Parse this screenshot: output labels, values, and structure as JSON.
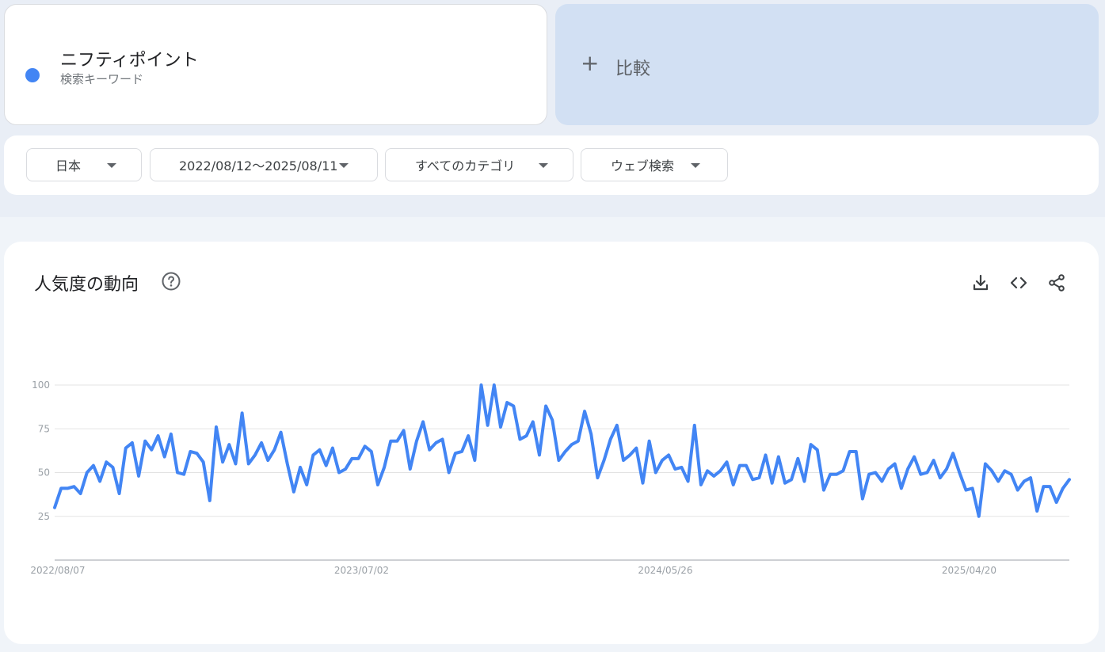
{
  "term": {
    "title": "ニフティポイント",
    "subtitle": "検索キーワード",
    "color": "#4285f4"
  },
  "compare": {
    "plus": "+",
    "label": "比較"
  },
  "filters": {
    "region": "日本",
    "date_range": "2022/08/12〜2025/08/11",
    "category": "すべてのカテゴリ",
    "search_type": "ウェブ検索"
  },
  "chart_card": {
    "title": "人気度の動向",
    "icons": [
      "help-icon",
      "download-icon",
      "embed-code-icon",
      "share-icon"
    ]
  },
  "chart_data": {
    "type": "line",
    "ylim": [
      0,
      100
    ],
    "yticks": [
      25,
      50,
      75,
      100
    ],
    "xtick_labels": [
      "2022/08/07",
      "2023/07/02",
      "2024/05/26",
      "2025/04/20"
    ],
    "grid": true,
    "series": [
      {
        "color": "#4285f4",
        "x_start": "2022/08/07",
        "x_interval_days": 7,
        "values": [
          30,
          41,
          41,
          42,
          38,
          50,
          54,
          45,
          56,
          53,
          38,
          64,
          67,
          48,
          68,
          63,
          71,
          59,
          72,
          50,
          49,
          62,
          61,
          56,
          34,
          76,
          56,
          66,
          55,
          84,
          55,
          60,
          67,
          57,
          63,
          73,
          55,
          39,
          53,
          43,
          60,
          63,
          54,
          64,
          50,
          52,
          58,
          58,
          65,
          62,
          43,
          53,
          68,
          68,
          74,
          52,
          68,
          79,
          63,
          67,
          69,
          50,
          61,
          62,
          71,
          57,
          100,
          77,
          100,
          76,
          90,
          88,
          69,
          71,
          79,
          60,
          88,
          80,
          57,
          62,
          66,
          68,
          85,
          72,
          47,
          57,
          69,
          77,
          57,
          60,
          64,
          44,
          68,
          50,
          57,
          60,
          52,
          53,
          45,
          77,
          43,
          51,
          48,
          51,
          56,
          43,
          54,
          54,
          46,
          47,
          60,
          44,
          59,
          44,
          46,
          58,
          45,
          66,
          63,
          40,
          49,
          49,
          51,
          62,
          62,
          35,
          49,
          50,
          45,
          52,
          55,
          41,
          52,
          59,
          49,
          50,
          57,
          47,
          52,
          61,
          50,
          40,
          41,
          25,
          55,
          51,
          45,
          51,
          49,
          40,
          45,
          47,
          28,
          42,
          42,
          33,
          41,
          46
        ]
      }
    ]
  }
}
